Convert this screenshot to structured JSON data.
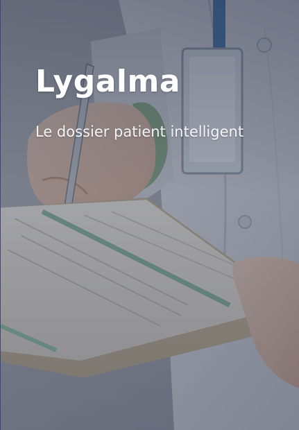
{
  "hero": {
    "title": "Lygalma",
    "tagline": "Le dossier patient intelligent"
  },
  "colors": {
    "overlay": "#2f3a52",
    "text": "#ffffff"
  }
}
